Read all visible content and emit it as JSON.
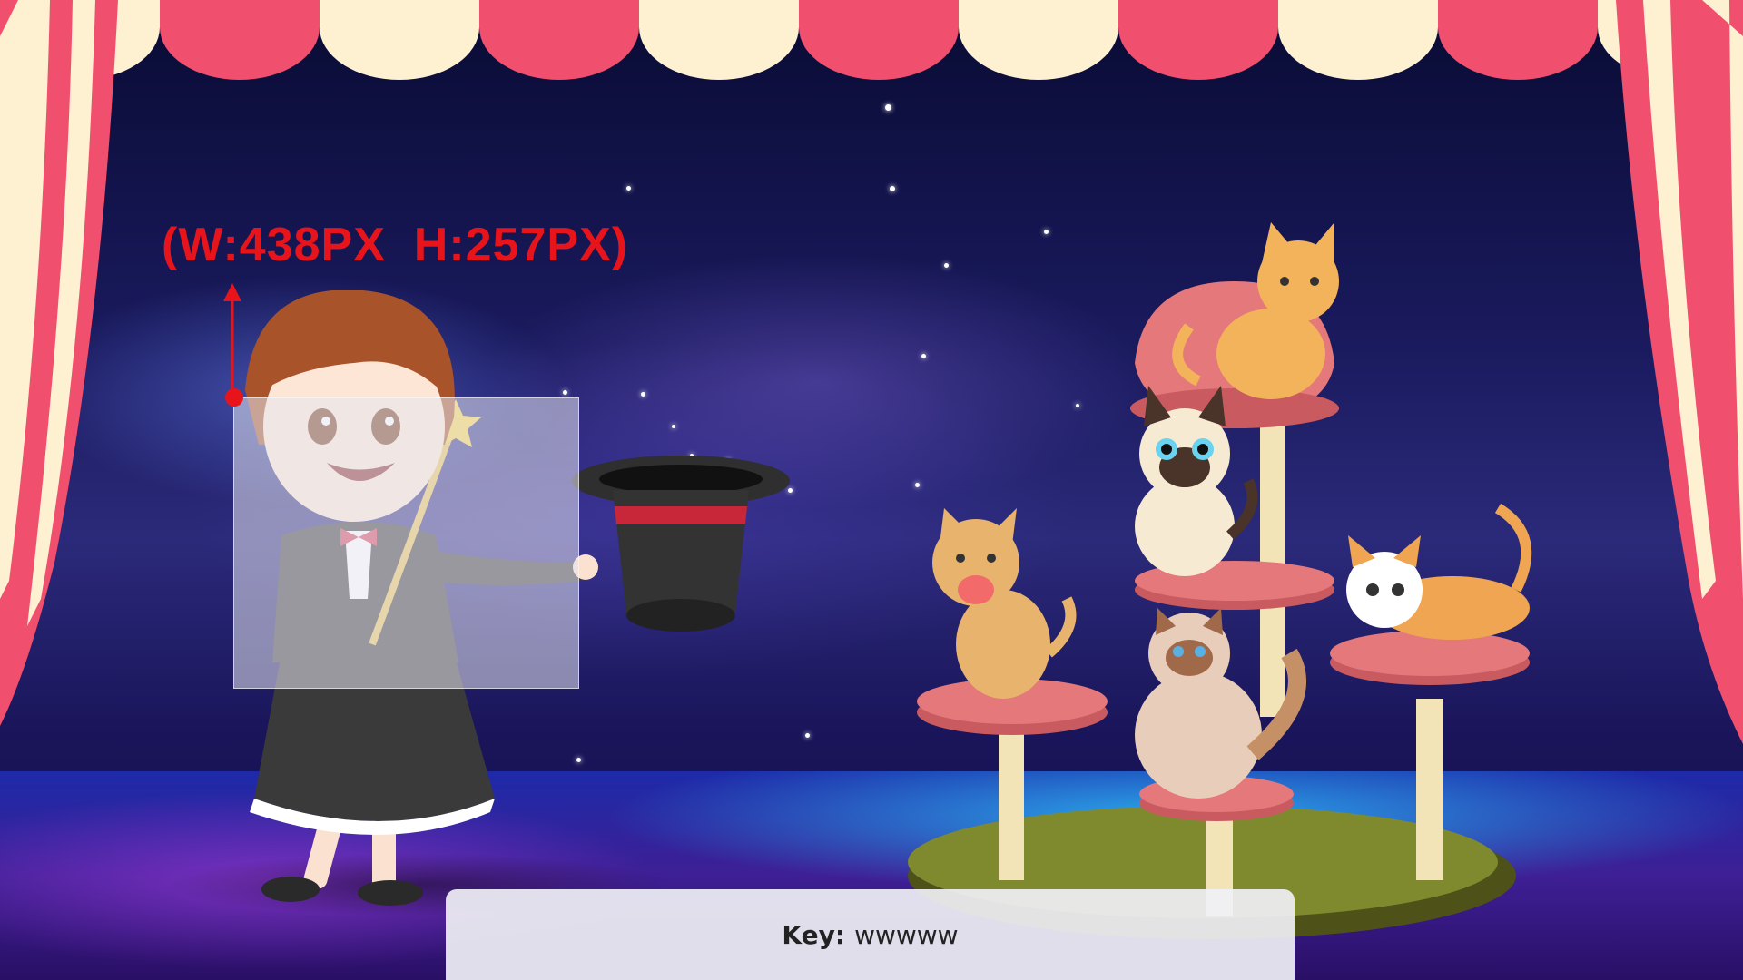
{
  "annotation": {
    "text": "(W:438PX  H:257PX)",
    "color": "#e8141b"
  },
  "key_bar": {
    "label": "Key:",
    "value": "wwwww"
  },
  "colors": {
    "curtain_red": "#f0506e",
    "curtain_cream": "#fdf1d2",
    "stage_blue": "#1d2aa8",
    "cattree_pink": "#e4787a",
    "cattree_base": "#7f8a2e"
  },
  "characters": [
    "magician-girl",
    "top-hat",
    "magic-wand",
    "orange-cat-top",
    "siamese-cat",
    "ginger-cat-left",
    "ragdoll-cat",
    "tiger-cat-lying"
  ]
}
